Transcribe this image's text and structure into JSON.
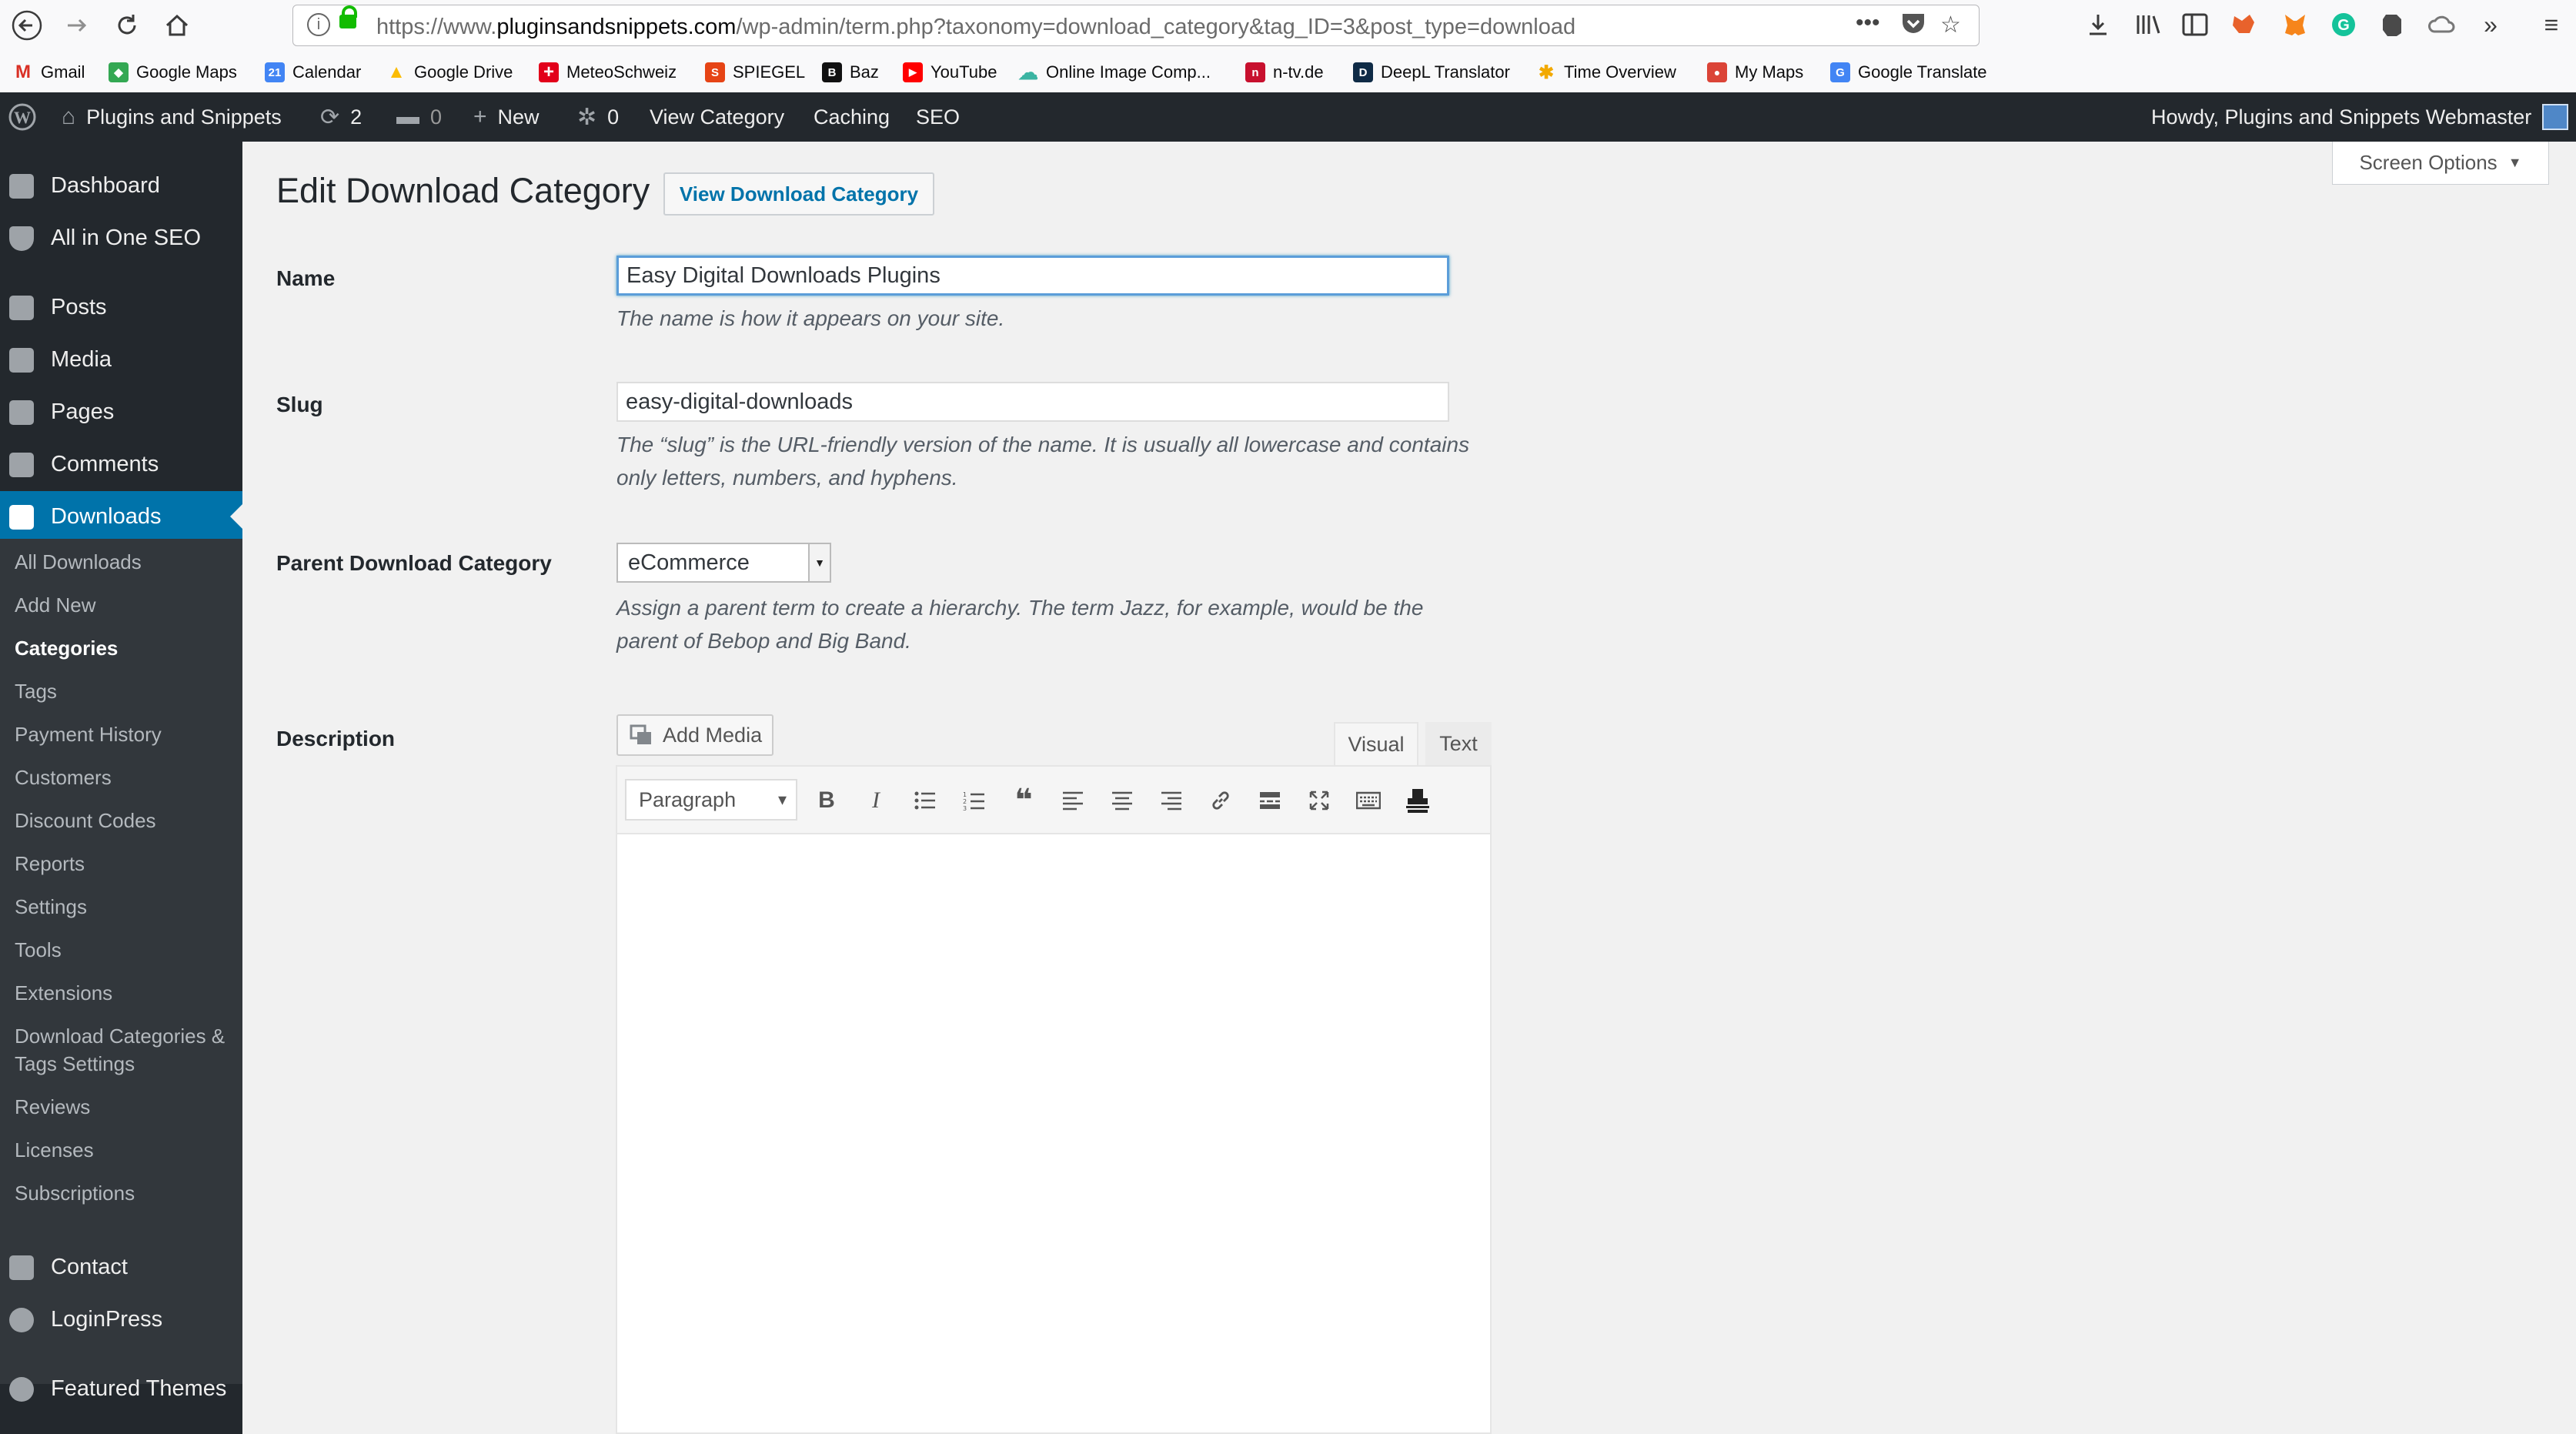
{
  "browser": {
    "url_prefix": "https://www.",
    "url_host": "pluginsandsnippets.com",
    "url_path": "/wp-admin/term.php?taxonomy=download_category&tag_ID=3&post_type=download",
    "bookmarks": [
      {
        "label": "Gmail",
        "fav": "M",
        "color": "#d93025"
      },
      {
        "label": "Google Maps",
        "fav": "◆",
        "color": "#34a853"
      },
      {
        "label": "Calendar",
        "fav": "21",
        "color": "#4285f4"
      },
      {
        "label": "Google Drive",
        "fav": "▲",
        "color": "#fbbc04"
      },
      {
        "label": "MeteoSchweiz",
        "fav": "+",
        "color": "#e2001a"
      },
      {
        "label": "SPIEGEL",
        "fav": "S",
        "color": "#e64415"
      },
      {
        "label": "Baz",
        "fav": "B",
        "color": "#111111"
      },
      {
        "label": "YouTube",
        "fav": "▶",
        "color": "#ff0000"
      },
      {
        "label": "Online Image Comp...",
        "fav": "☁",
        "color": "#3bb4a2"
      },
      {
        "label": "n-tv.de",
        "fav": "n",
        "color": "#c8102e"
      },
      {
        "label": "DeepL Translator",
        "fav": "D",
        "color": "#0f2b46"
      },
      {
        "label": "Time Overview",
        "fav": "✱",
        "color": "#f2a900"
      },
      {
        "label": "My Maps",
        "fav": "●",
        "color": "#db4437"
      },
      {
        "label": "Google Translate",
        "fav": "G",
        "color": "#4285f4"
      }
    ]
  },
  "admin_bar": {
    "site_name": "Plugins and Snippets",
    "updates_count": "2",
    "comments_count": "0",
    "new_label": "New",
    "woo_count": "0",
    "view_category": "View Category",
    "caching": "Caching",
    "seo": "SEO",
    "howdy": "Howdy, Plugins and Snippets Webmaster"
  },
  "sidebar": {
    "top_items": [
      "Dashboard",
      "All in One SEO",
      "Posts",
      "Media",
      "Pages",
      "Comments",
      "Downloads"
    ],
    "sub_items": [
      "All Downloads",
      "Add New",
      "Categories",
      "Tags",
      "Payment History",
      "Customers",
      "Discount Codes",
      "Reports",
      "Settings",
      "Tools",
      "Extensions",
      "Download Categories & Tags Settings",
      "Reviews",
      "Licenses",
      "Subscriptions"
    ],
    "bottom_items": [
      "Contact",
      "LoginPress",
      "Featured Themes"
    ]
  },
  "screen_options": "Screen Options",
  "page": {
    "title": "Edit Download Category",
    "view_button": "View Download Category"
  },
  "form": {
    "name_label": "Name",
    "name_value": "Easy Digital Downloads Plugins",
    "name_help": "The name is how it appears on your site.",
    "slug_label": "Slug",
    "slug_value": "easy-digital-downloads",
    "slug_help": "The “slug” is the URL-friendly version of the name. It is usually all lowercase and contains only letters, numbers, and hyphens.",
    "parent_label": "Parent Download Category",
    "parent_value": "eCommerce",
    "parent_help": "Assign a parent term to create a hierarchy. The term Jazz, for example, would be the parent of Bebop and Big Band.",
    "description_label": "Description"
  },
  "editor": {
    "add_media": "Add Media",
    "tab_visual": "Visual",
    "tab_text": "Text",
    "format_value": "Paragraph",
    "content": ""
  }
}
